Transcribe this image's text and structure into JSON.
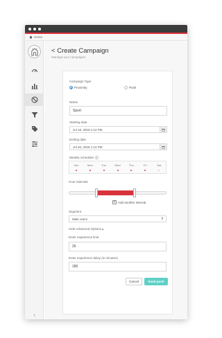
{
  "breadcrumb": {
    "home": "Home"
  },
  "page": {
    "title": "Create Campaign",
    "back_glyph": "<",
    "subtitle": "Manage your campaigns"
  },
  "form": {
    "campaign_type_label": "Campaign Type",
    "type_options": [
      "Proximity",
      "Push"
    ],
    "type_selected": "Proximity",
    "name_label": "Name",
    "name_value": "Sport",
    "start_label": "Starting date",
    "start_value": "Jul 18, 2018 1:12 PM",
    "end_label": "Ending date",
    "end_value": "Jul 26, 2018 1:12 PM",
    "weekly_label": "Weekly scheduler",
    "days": [
      "Sun",
      "Mon",
      "Tue",
      "Wed",
      "Thu",
      "Fri",
      "Sat"
    ],
    "days_active": [
      true,
      true,
      true,
      true,
      true,
      true,
      false
    ],
    "hours_label": "Hour intervals",
    "add_interval": "Add another interval",
    "segment_label": "Segment",
    "segment_value": "Male users",
    "hide_advanced": "Hide Advanced Options",
    "limit_label": "Enter experience limit",
    "limit_value": "26",
    "delay_label": "Enter experience delay (in minutes)",
    "delay_value": "180",
    "cancel": "Cancel",
    "send": "Send push"
  },
  "colors": {
    "accent": "#e0323a",
    "primary": "#5fd0c6",
    "radio": "#3a8fd6"
  },
  "icons": [
    "home-icon",
    "logo-icon",
    "dashboard-icon",
    "analytics-icon",
    "campaigns-icon",
    "filter-icon",
    "tag-icon",
    "settings-icon",
    "calendar-icon",
    "info-icon",
    "plus-icon",
    "collapse-icon"
  ]
}
